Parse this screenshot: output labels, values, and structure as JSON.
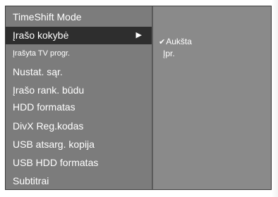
{
  "menu": {
    "items": [
      {
        "label": "TimeShift Mode",
        "selected": false
      },
      {
        "label": "Įrašo kokybė",
        "selected": true,
        "arrow": "▶"
      },
      {
        "label": "Įrašyta TV progr.",
        "selected": false
      },
      {
        "label": "Nustat. sąr.",
        "selected": false
      },
      {
        "label": "Įrašo rank. būdu",
        "selected": false
      },
      {
        "label": "HDD formatas",
        "selected": false
      },
      {
        "label": "DivX Reg.kodas",
        "selected": false
      },
      {
        "label": "USB atsarg. kopija",
        "selected": false
      },
      {
        "label": "USB HDD formatas",
        "selected": false
      },
      {
        "label": "Subtitrai",
        "selected": false
      }
    ]
  },
  "submenu": {
    "check_glyph": "✔",
    "options": [
      {
        "label": "Aukšta",
        "checked": true
      },
      {
        "label": "Įpr.",
        "checked": false
      }
    ]
  },
  "colors": {
    "panel_bg": "#7c7c7c",
    "highlight_bg": "#2e2e2e",
    "text": "#ffffff"
  }
}
